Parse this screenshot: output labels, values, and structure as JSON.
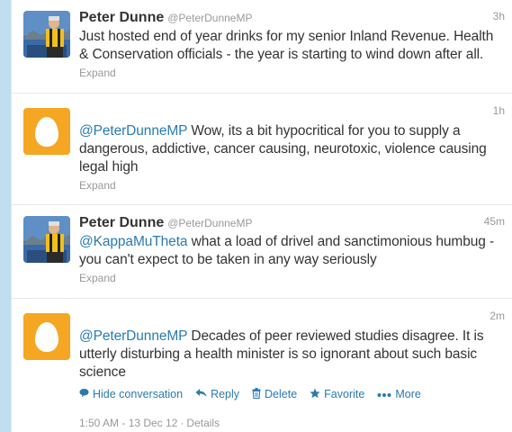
{
  "tweets": [
    {
      "fullname": "Peter Dunne",
      "username": "@PeterDunneMP",
      "time": "3h",
      "text": "Just hosted end of year drinks for my senior Inland Revenue. Health & Conservation officials - the year is starting to wind down after all.",
      "expand": "Expand"
    },
    {
      "time": "1h",
      "mention": "@PeterDunneMP",
      "text": " Wow, its a bit hypocritical for you to supply a dangerous, addictive, cancer causing, neurotoxic, violence causing legal high",
      "expand": "Expand"
    },
    {
      "fullname": "Peter Dunne",
      "username": "@PeterDunneMP",
      "time": "45m",
      "mention": "@KappaMuTheta",
      "text": " what a load of drivel and sanctimonious humbug - you can't expect to be taken in any way seriously",
      "expand": "Expand"
    },
    {
      "time": "2m",
      "mention": "@PeterDunneMP",
      "text": " Decades of peer reviewed studies disagree. It is utterly disturbing a health minister is so ignorant about such basic science",
      "actions": {
        "hide": "Hide conversation",
        "reply": "Reply",
        "delete": "Delete",
        "favorite": "Favorite",
        "more": "More"
      },
      "timestamp": "1:50 AM - 13 Dec 12",
      "details": "Details"
    }
  ],
  "colors": {
    "link": "#2a7ab0",
    "muted": "#999999",
    "egg": "#f5a623",
    "background": "#c0deed"
  },
  "icons": [
    "speech-bubble-icon",
    "reply-arrow-icon",
    "trash-icon",
    "star-icon",
    "ellipsis-icon"
  ]
}
